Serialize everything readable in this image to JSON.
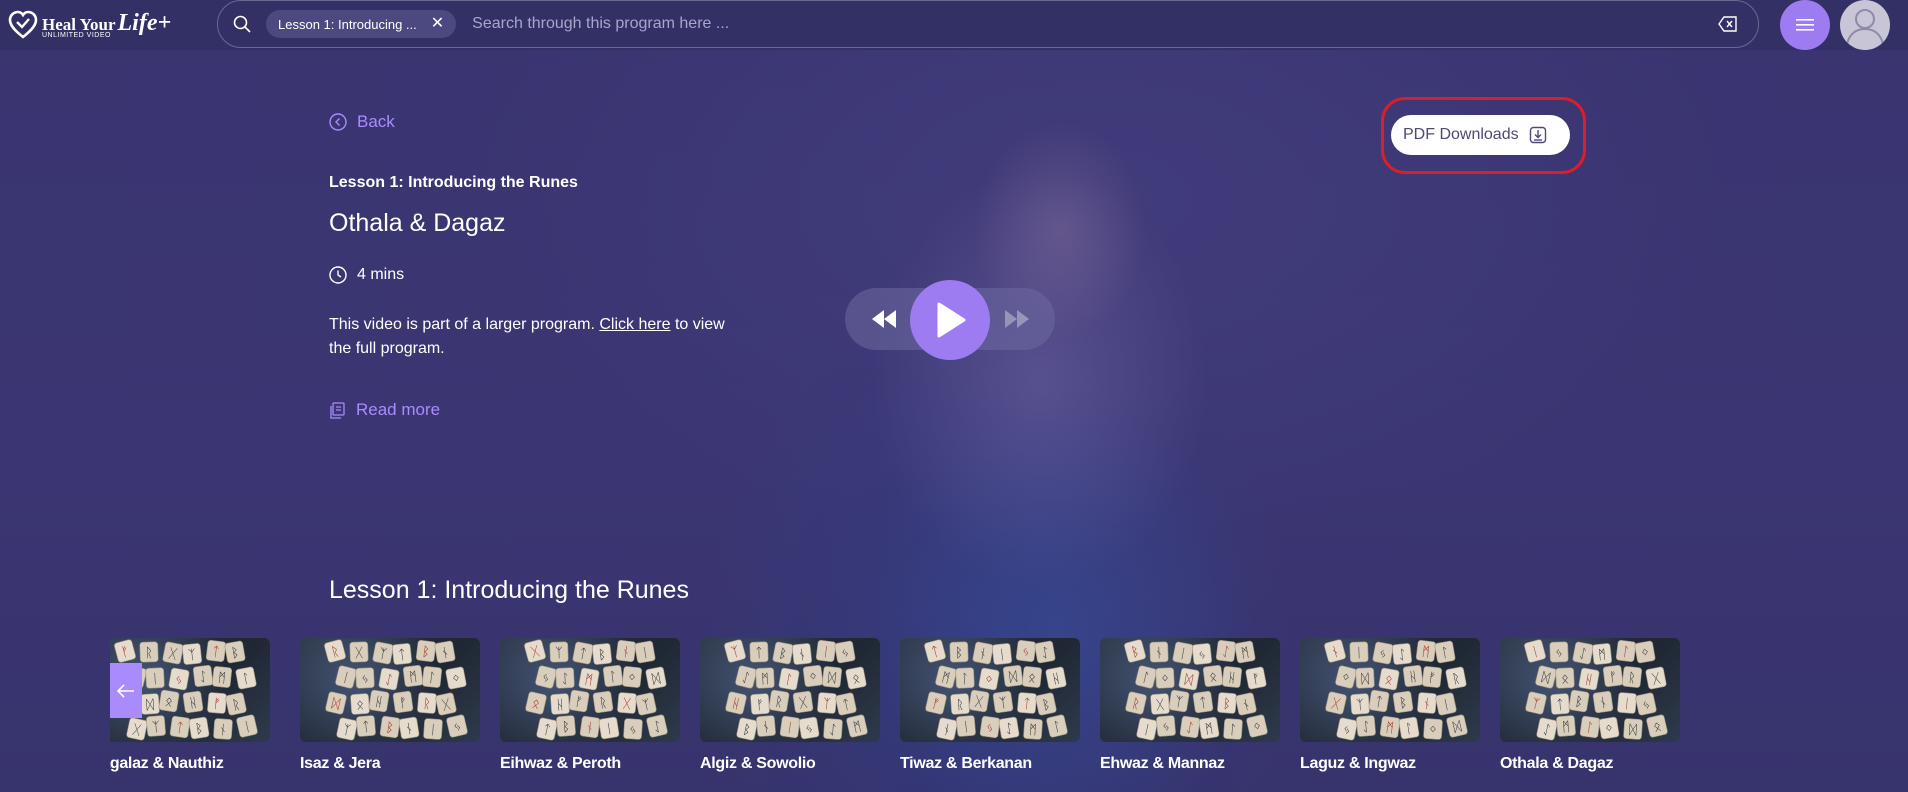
{
  "brand": {
    "line1": "Heal Your",
    "line1_script": "Life+",
    "line2": "UNLIMITED VIDEO"
  },
  "search": {
    "chip_label": "Lesson 1: Introducing ...",
    "placeholder": "Search through this program here ..."
  },
  "nav": {
    "back_label": "Back"
  },
  "video": {
    "lesson_label": "Lesson 1: Introducing the Runes",
    "title": "Othala & Dagaz",
    "duration": "4 mins",
    "desc_prefix": "This video is part of a larger program.",
    "desc_link": "Click here",
    "desc_suffix": "to view the full program.",
    "read_more": "Read more"
  },
  "pdf": {
    "label": "PDF Downloads"
  },
  "section": {
    "title": "Lesson 1: Introducing the Runes",
    "items": [
      {
        "title": "Hagalaz & Nauthiz"
      },
      {
        "title": "Isaz & Jera"
      },
      {
        "title": "Eihwaz & Peroth"
      },
      {
        "title": "Algiz & Sowolio"
      },
      {
        "title": "Tiwaz & Berkanan"
      },
      {
        "title": "Ehwaz & Mannaz"
      },
      {
        "title": "Laguz & Ingwaz"
      },
      {
        "title": "Othala & Dagaz"
      }
    ]
  },
  "colors": {
    "accent": "#9d7cf2",
    "link": "#a98bfb",
    "highlight": "#d81f2b",
    "bg": "#3b3672"
  }
}
